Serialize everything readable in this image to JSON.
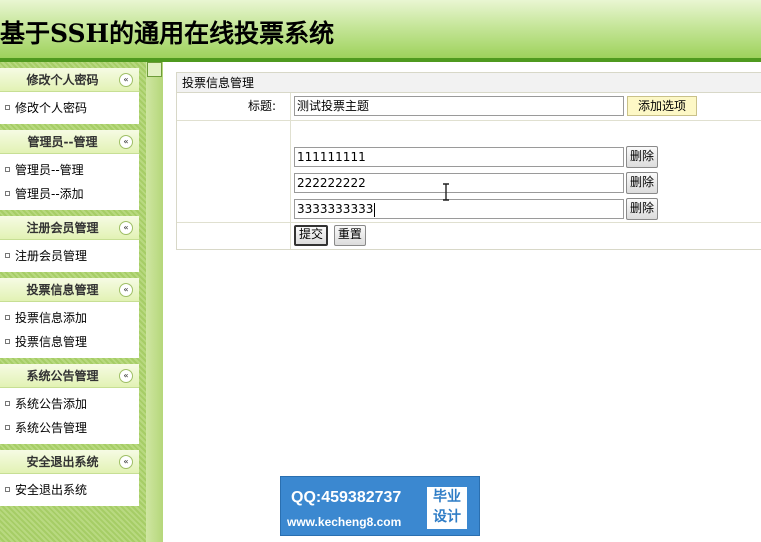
{
  "header": {
    "title": "基于SSH的通用在线投票系统"
  },
  "sidebar": {
    "groups": [
      {
        "title": "修改个人密码",
        "items": [
          "修改个人密码"
        ]
      },
      {
        "title": "管理员--管理",
        "items": [
          "管理员--管理",
          "管理员--添加"
        ]
      },
      {
        "title": "注册会员管理",
        "items": [
          "注册会员管理"
        ]
      },
      {
        "title": "投票信息管理",
        "items": [
          "投票信息添加",
          "投票信息管理"
        ]
      },
      {
        "title": "系统公告管理",
        "items": [
          "系统公告添加",
          "系统公告管理"
        ]
      },
      {
        "title": "安全退出系统",
        "items": [
          "安全退出系统"
        ]
      }
    ],
    "collapse_glyph": "«"
  },
  "main": {
    "panel_title": "投票信息管理",
    "title_label": "标题:",
    "title_value": "测试投票主题",
    "add_option_label": "添加选项",
    "options": [
      "111111111",
      "222222222",
      "3333333333"
    ],
    "delete_label": "删除",
    "submit_label": "提交",
    "reset_label": "重置"
  },
  "watermark": {
    "qq": "QQ:459382737",
    "url": "www.kecheng8.com",
    "badge_line1": "毕业",
    "badge_line2": "设计"
  }
}
